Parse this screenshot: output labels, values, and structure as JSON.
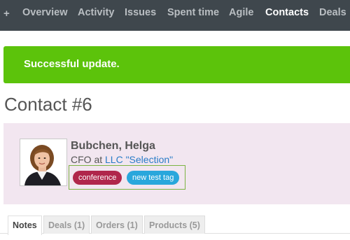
{
  "nav": {
    "plus": "+",
    "items": [
      "Overview",
      "Activity",
      "Issues",
      "Spent time",
      "Agile",
      "Contacts",
      "Deals"
    ],
    "active": "Contacts"
  },
  "flash": {
    "message": "Successful update."
  },
  "title": "Contact #6",
  "contact": {
    "name": "Bubchen, Helga",
    "job_title": "CFO at",
    "company": "LLC \"Selection\"",
    "tags": [
      {
        "label": "conference",
        "color": "#b0264b"
      },
      {
        "label": "new test tag",
        "color": "#29a7dc"
      }
    ]
  },
  "tabs": [
    {
      "label": "Notes",
      "active": true
    },
    {
      "label": "Deals (1)"
    },
    {
      "label": "Orders (1)"
    },
    {
      "label": "Products (5)"
    }
  ],
  "colors": {
    "nav_bg": "#3f474d",
    "flash_bg": "#5cc30b",
    "card_bg": "#f2e6f0",
    "link": "#2a7cc7"
  }
}
